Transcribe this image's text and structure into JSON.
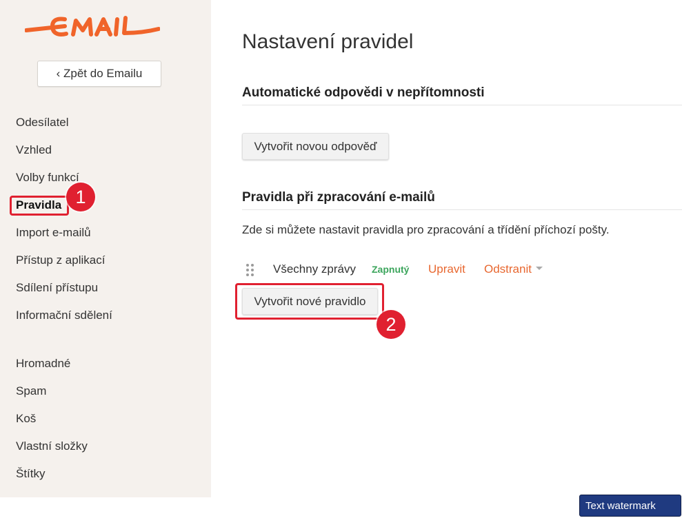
{
  "colors": {
    "sidebar_bg": "#f5f1ed",
    "brand_orange": "#f0642a",
    "link_orange": "#e8672f",
    "status_green": "#3ca55c",
    "callout_red": "#e02030"
  },
  "sidebar": {
    "logo_text": "EMAIL",
    "back_button": "‹ Zpět do Emailu",
    "settings_items": [
      {
        "label": "Odesílatel",
        "active": false
      },
      {
        "label": "Vzhled",
        "active": false
      },
      {
        "label": "Volby funkcí",
        "active": false
      },
      {
        "label": "Pravidla",
        "active": true
      },
      {
        "label": "Import e-mailů",
        "active": false
      },
      {
        "label": "Přístup z aplikací",
        "active": false
      },
      {
        "label": "Sdílení přístupu",
        "active": false
      },
      {
        "label": "Informační sdělení",
        "active": false
      }
    ],
    "folder_items": [
      {
        "label": "Hromadné"
      },
      {
        "label": "Spam"
      },
      {
        "label": "Koš"
      },
      {
        "label": "Vlastní složky"
      },
      {
        "label": "Štítky"
      }
    ]
  },
  "main": {
    "title": "Nastavení pravidel",
    "auto_reply": {
      "heading": "Automatické odpovědi v nepřítomnosti",
      "create_button": "Vytvořit novou odpověď"
    },
    "rules": {
      "heading": "Pravidla při zpracování e-mailů",
      "description": "Zde si můžete nastavit pravidla pro zpracování a třídění příchozí pošty.",
      "items": [
        {
          "name": "Všechny zprávy",
          "status": "Zapnutý",
          "edit_label": "Upravit",
          "delete_label": "Odstranit"
        }
      ],
      "create_button": "Vytvořit nové pravidlo"
    }
  },
  "annotations": {
    "badge_1": "1",
    "badge_2": "2"
  },
  "watermark": "Text watermark"
}
